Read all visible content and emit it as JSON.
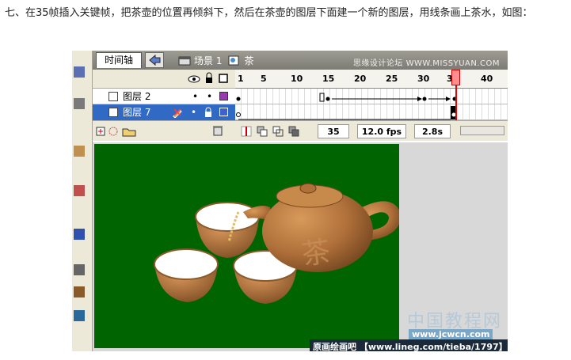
{
  "instruction": "七、在35帧插入关键帧，把茶壶的位置再倾斜下，然后在茶壶的图层下面建一个新的图层，用线条画上茶水，如图：",
  "tabs": {
    "timeline_label": "时间轴",
    "scene_label": "场景 1",
    "symbol_label": "茶"
  },
  "brand_text": "思缘设计论坛 WWW.MISSYUAN.COM",
  "ruler_marks": [
    "1",
    "5",
    "10",
    "15",
    "20",
    "25",
    "30",
    "35",
    "40"
  ],
  "layers": [
    {
      "name": "图层 2",
      "selected": false
    },
    {
      "name": "图层 7",
      "selected": true
    }
  ],
  "status": {
    "current_frame": "35",
    "fps": "12.0 fps",
    "elapsed": "2.8s"
  },
  "stage": {
    "teapot_character": "茶"
  },
  "watermarks": {
    "cn": "中国教程网",
    "url": "www.jcwcn.com",
    "bar": "原画绘画吧 【www.lineg.com/tieba/1797】"
  },
  "colors": {
    "stage_green": "#006400",
    "teapot_brown": "#b0703a",
    "selected_layer": "#316ac5"
  }
}
